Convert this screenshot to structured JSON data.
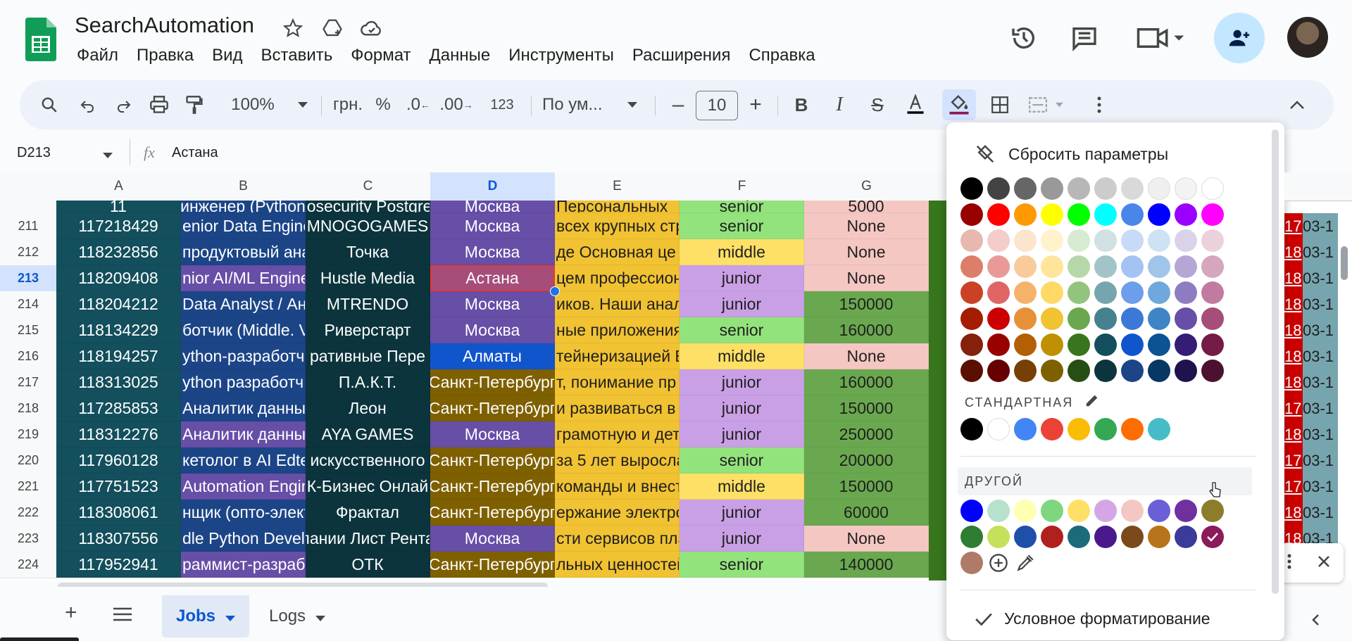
{
  "app": {
    "title": "SearchAutomation",
    "menu": [
      "Файл",
      "Правка",
      "Вид",
      "Вставить",
      "Формат",
      "Данные",
      "Инструменты",
      "Расширения",
      "Справка"
    ]
  },
  "toolbar": {
    "zoom": "100%",
    "currency": "грн.",
    "percent": "%",
    "dec_less": ".0",
    "dec_more": ".00",
    "number_format": "123",
    "font": "По ум...",
    "font_size": "10",
    "minus": "–",
    "plus": "+"
  },
  "formula_bar": {
    "cell_ref": "D213",
    "fx": "fx",
    "value": "Астана"
  },
  "columns": [
    "A",
    "B",
    "C",
    "D",
    "E",
    "F",
    "G"
  ],
  "rows": [
    {
      "num": "211",
      "A": "117218429",
      "B": "enior Data Engine",
      "C": "MNOGOGAMES",
      "D": "Москва",
      "E": "всех крупных стр",
      "F": "senior",
      "G": "None",
      "Hr": "17",
      "Hs": "03-1"
    },
    {
      "num": "212",
      "A": "118232856",
      "B": "продуктовый ана",
      "C": "Точка",
      "D": "Москва",
      "E": "де Основная це",
      "F": "middle",
      "G": "None",
      "Hr": "18",
      "Hs": "03-1"
    },
    {
      "num": "213",
      "A": "118209408",
      "B": "nior AI/ML Engine",
      "C": "Hustle Media",
      "D": "Астана",
      "E": "цем профессиона",
      "F": "junior",
      "G": "None",
      "Hr": "18",
      "Hs": "03-1"
    },
    {
      "num": "214",
      "A": "118204212",
      "B": "Data Analyst / Ан",
      "C": "MTRENDO",
      "D": "Москва",
      "E": "иков. Наши анал",
      "F": "junior",
      "G": "150000",
      "Hr": "18",
      "Hs": "03-1"
    },
    {
      "num": "215",
      "A": "118134229",
      "B": "ботчик (Middle. V",
      "C": "Риверстарт",
      "D": "Москва",
      "E": "ные приложения",
      "F": "senior",
      "G": "160000",
      "Hr": "18",
      "Hs": "03-1"
    },
    {
      "num": "216",
      "A": "118194257",
      "B": "ython-разработч",
      "C": "ративные Пере",
      "D": "Алматы",
      "E": "тейнеризацией Е",
      "F": "middle",
      "G": "None",
      "Hr": "18",
      "Hs": "03-1"
    },
    {
      "num": "217",
      "A": "118313025",
      "B": "ython разработч",
      "C": "П.А.К.Т.",
      "D": "Санкт-Петербург",
      "E": "т, понимание пр",
      "F": "junior",
      "G": "160000",
      "Hr": "18",
      "Hs": "03-1"
    },
    {
      "num": "218",
      "A": "117285853",
      "B": "Аналитик данных",
      "C": "Леон",
      "D": "Санкт-Петербург",
      "E": "и развиваться в",
      "F": "junior",
      "G": "150000",
      "Hr": "17",
      "Hs": "03-1"
    },
    {
      "num": "219",
      "A": "118312276",
      "B": "Аналитик данных",
      "C": "AYA GAMES",
      "D": "Москва",
      "E": "грамотную и дет",
      "F": "junior",
      "G": "250000",
      "Hr": "18",
      "Hs": "03-1"
    },
    {
      "num": "220",
      "A": "117960128",
      "B": "кетолог в AI Edte",
      "C": "искусственного",
      "D": "Санкт-Петербург",
      "E": "за 5 лет выросла",
      "F": "senior",
      "G": "200000",
      "Hr": "17",
      "Hs": "03-1"
    },
    {
      "num": "221",
      "A": "117751523",
      "B": "Automation Engin",
      "C": "К-Бизнес Онлай",
      "D": "Санкт-Петербург",
      "E": "команды и внест",
      "F": "middle",
      "G": "150000",
      "Hr": "17",
      "Hs": "03-1"
    },
    {
      "num": "222",
      "A": "118308061",
      "B": "нщик (опто-элект",
      "C": "Фрактал",
      "D": "Санкт-Петербург",
      "E": "ержание электро",
      "F": "junior",
      "G": "60000",
      "Hr": "18",
      "Hs": "03-1"
    },
    {
      "num": "223",
      "A": "118307556",
      "B": "dle Python Devel",
      "C": "пании Лист Рента",
      "D": "Москва",
      "E": "сти сервисов пла",
      "F": "junior",
      "G": "None",
      "Hr": "18",
      "Hs": "03-1"
    },
    {
      "num": "224",
      "A": "117952941",
      "B": "раммист-разрабо",
      "C": "ОТК",
      "D": "Санкт-Петербург",
      "E": "льных ценностей",
      "F": "senior",
      "G": "140000",
      "Hr": "17",
      "Hs": "03-1"
    }
  ],
  "top_partial_row": {
    "A": "11",
    "B": "инженер (Python",
    "C": "Rosecurity Postgres",
    "D": "Москва",
    "E": "Персональных",
    "F": "senior",
    "G": "5000"
  },
  "sheets": {
    "add": "+",
    "tabs": [
      "Jobs",
      "Logs"
    ]
  },
  "color_picker": {
    "reset_label": "Сбросить параметры",
    "standard_label": "СТАНДАРТНАЯ",
    "custom_label": "ДРУГОЙ",
    "conditional_label": "Условное форматирование",
    "grid": [
      [
        "#000000",
        "#434343",
        "#666666",
        "#999999",
        "#b7b7b7",
        "#cccccc",
        "#d9d9d9",
        "#efefef",
        "#f3f3f3",
        "#ffffff"
      ],
      [
        "#980000",
        "#ff0000",
        "#ff9900",
        "#ffff00",
        "#00ff00",
        "#00ffff",
        "#4a86e8",
        "#0000ff",
        "#9900ff",
        "#ff00ff"
      ],
      [
        "#e6b8af",
        "#f4cccc",
        "#fce5cd",
        "#fff2cc",
        "#d9ead3",
        "#d0e0e3",
        "#c9daf8",
        "#cfe2f3",
        "#d9d2e9",
        "#ead1dc"
      ],
      [
        "#dd7e6b",
        "#ea9999",
        "#f9cb9c",
        "#ffe599",
        "#b6d7a8",
        "#a2c4c9",
        "#a4c2f4",
        "#9fc5e8",
        "#b4a7d6",
        "#d5a6bd"
      ],
      [
        "#cc4125",
        "#e06666",
        "#f6b26b",
        "#ffd966",
        "#93c47d",
        "#76a5af",
        "#6d9eeb",
        "#6fa8dc",
        "#8e7cc3",
        "#c27ba0"
      ],
      [
        "#a61c00",
        "#cc0000",
        "#e69138",
        "#f1c232",
        "#6aa84f",
        "#45818e",
        "#3c78d8",
        "#3d85c6",
        "#674ea7",
        "#a64d79"
      ],
      [
        "#85200c",
        "#990000",
        "#b45f06",
        "#bf9000",
        "#38761d",
        "#134f5c",
        "#1155cc",
        "#0b5394",
        "#351c75",
        "#741b47"
      ],
      [
        "#5b0f00",
        "#660000",
        "#783f04",
        "#7f6000",
        "#274e13",
        "#0c343d",
        "#1c4587",
        "#073763",
        "#20124d",
        "#4c1130"
      ]
    ],
    "standard": [
      "#000000",
      "#ffffff",
      "#4285f4",
      "#ea4335",
      "#fbbc04",
      "#34a853",
      "#ff6d01",
      "#46bdc6"
    ],
    "custom": [
      [
        "#0000ff",
        "#b7e1cd",
        "#ffffb3",
        "#7fd67f",
        "#ffe066",
        "#d5a6e6",
        "#f4c7c3",
        "#6a5fd6",
        "#7030a0",
        "#8b7d2a"
      ],
      [
        "#2e7d32",
        "#c5e05a",
        "#1f4fa8",
        "#b0201f",
        "#1b6b7a",
        "#4a1a8c",
        "#7b4a1a",
        "#b8741a",
        "#3b3b9a",
        "#8b1a5a"
      ]
    ],
    "custom_extra": "#b07a68",
    "selected_color": "#8b1a5a"
  }
}
